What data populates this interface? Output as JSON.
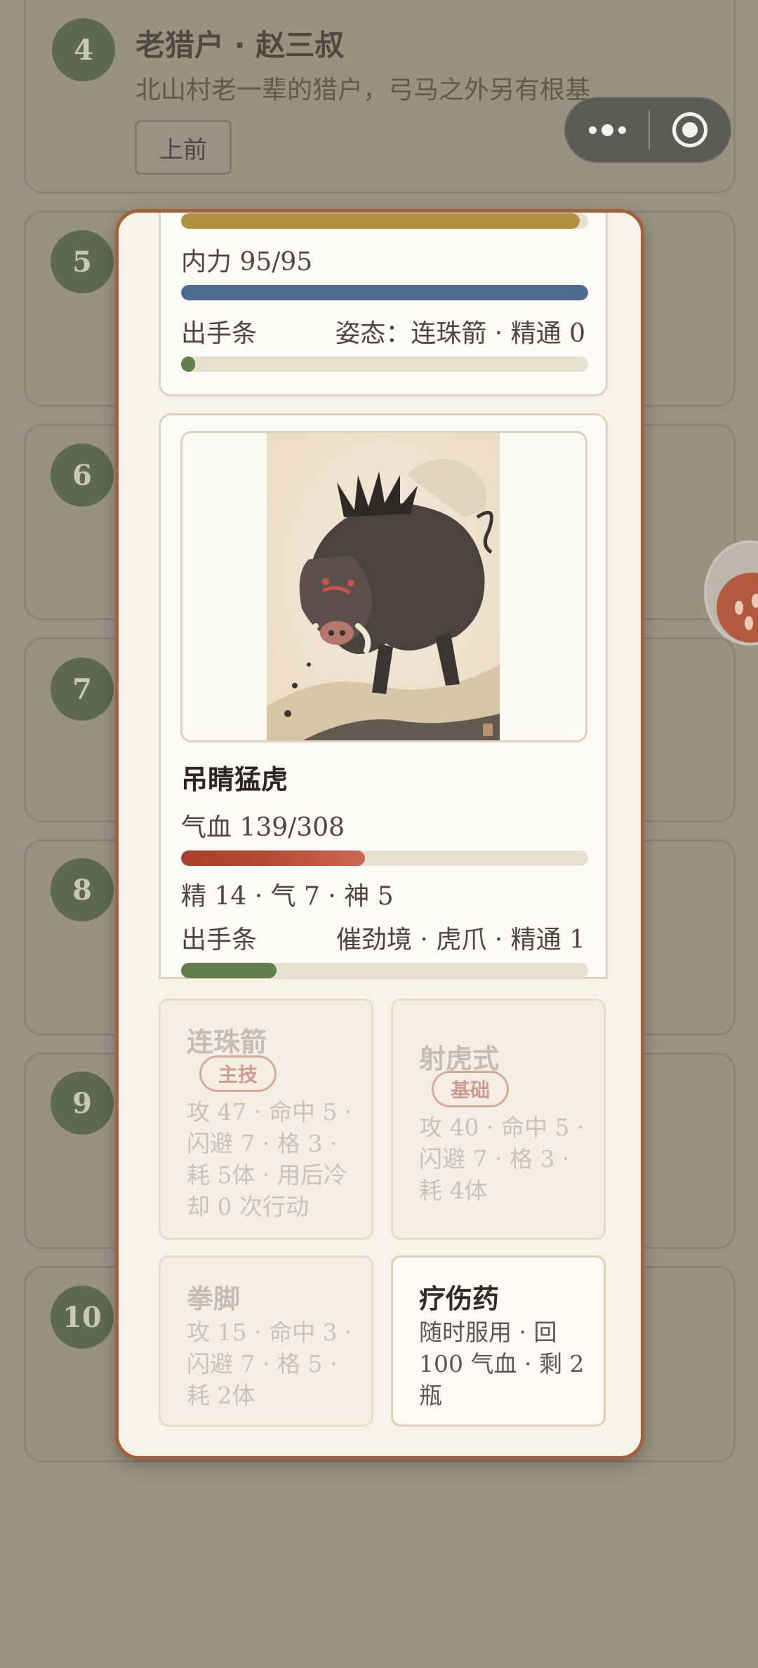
{
  "background_list": {
    "items": [
      {
        "num": "4",
        "name": "老猎户 · 赵三叔",
        "desc": "北山村老一辈的猎户，弓马之外另有根基",
        "action": "上前"
      },
      {
        "num": "5"
      },
      {
        "num": "6"
      },
      {
        "num": "7"
      },
      {
        "num": "8"
      },
      {
        "num": "9"
      },
      {
        "num": "10"
      }
    ]
  },
  "player": {
    "neili_text": "内力 95/95",
    "hp_fill": 0.98,
    "neili_fill": 1.0,
    "turn_label": "出手条",
    "stance_text": "姿态：连珠箭 · 精通 0",
    "turn_fill": 0.03,
    "colors": {
      "hp": "#b0913f",
      "neili": "#4e6a8e",
      "turn": "#5f7f4b"
    }
  },
  "enemy": {
    "name": "吊睛猛虎",
    "hp_text": "气血 139/308",
    "hp_fill": 0.451,
    "attrs_text": "精 14 · 气 7 · 神 5",
    "turn_label": "出手条",
    "stance_text": "催劲境 · 虎爪 · 精通 1",
    "turn_fill": 0.235,
    "portrait": "wild-boar-ink-painting",
    "colors": {
      "hp": "#b54a36",
      "turn": "#5f7f4b"
    }
  },
  "skills": [
    {
      "name": "连珠箭",
      "tag": "主技",
      "desc": "攻 47 · 命中 5 · 闪避 7 · 格 3 · 耗 5体 · 用后冷却 0 次行动"
    },
    {
      "name": "射虎式",
      "tag": "基础",
      "desc": "攻 40 · 命中 5 · 闪避 7 · 格 3 · 耗 4体"
    },
    {
      "name": "拳脚",
      "desc": "攻 15 · 命中 3 · 闪避 7 · 格 5 · 耗 2体"
    },
    {
      "name": "疗伤药",
      "desc": "随时服用 · 回 100 气血 · 剩 2 瓶"
    }
  ],
  "capsule": {
    "more_icon": "more-dots-icon",
    "close_icon": "target-close-icon"
  }
}
